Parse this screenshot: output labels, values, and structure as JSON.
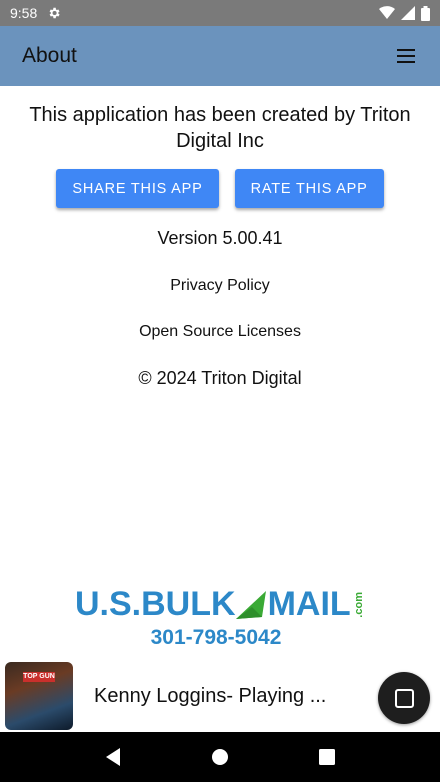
{
  "status_bar": {
    "time": "9:58"
  },
  "app_bar": {
    "title": "About"
  },
  "about": {
    "created_by": "This application has been created by Triton Digital Inc",
    "share_label": "SHARE THIS APP",
    "rate_label": "RATE THIS APP",
    "version": "Version 5.00.41",
    "privacy_label": "Privacy Policy",
    "oss_label": "Open Source Licenses",
    "copyright": "© 2024 Triton Digital"
  },
  "ad": {
    "logo_us": "U.S.",
    "logo_bulk": "BULK",
    "logo_mail": "MAIL",
    "logo_com": ".com",
    "phone": "301-798-5042"
  },
  "player": {
    "album_label": "TOP GUN",
    "track": "Kenny Loggins- Playing ..."
  },
  "colors": {
    "app_bar": "#6b93bd",
    "button": "#3f87f5",
    "status_bar": "#7a7a7a"
  }
}
